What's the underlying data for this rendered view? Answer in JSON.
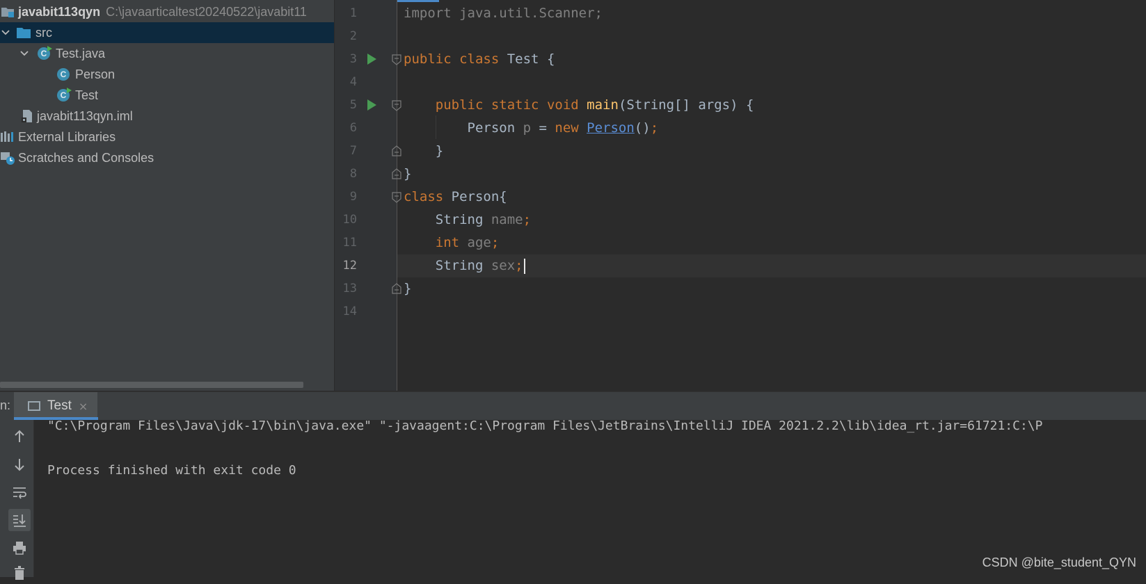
{
  "project_tree": {
    "root_name": "javabit113qyn",
    "root_path": "C:\\javaarticaltest20240522\\javabit11",
    "src_label": "src",
    "file_label": "Test.java",
    "class_person": "Person",
    "class_test": "Test",
    "iml_label": "javabit113qyn.iml",
    "external_libraries": "External Libraries",
    "scratches": "Scratches and Consoles"
  },
  "editor": {
    "line_numbers": [
      "1",
      "2",
      "3",
      "4",
      "5",
      "6",
      "7",
      "8",
      "9",
      "10",
      "11",
      "12",
      "13",
      "14"
    ],
    "current_line": "12",
    "code": {
      "l1_import": "import",
      "l1_rest": " java.util.Scanner;",
      "public": "public",
      "class": "class",
      "test_name": " Test ",
      "brace_open": "{",
      "static": "static",
      "void": "void",
      "main": "main",
      "main_args": "(String[] args) {",
      "person_type": "Person ",
      "var_p": "p",
      "assign": " = ",
      "new": "new",
      "person_ctor": "Person",
      "parens": "()",
      "semi": ";",
      "close_brace": "}",
      "person_decl": " Person{",
      "string_type": "String ",
      "name_field": "name",
      "int": "int",
      "age_field": "age",
      "sex_field": "sex"
    }
  },
  "run_panel": {
    "label": "n:",
    "tab_label": "Test",
    "tab_close": "×",
    "console_line1": "\"C:\\Program Files\\Java\\jdk-17\\bin\\java.exe\" \"-javaagent:C:\\Program Files\\JetBrains\\IntelliJ IDEA 2021.2.2\\lib\\idea_rt.jar=61721:C:\\P",
    "console_line2": "Process finished with exit code 0"
  },
  "watermark": "CSDN @bite_student_QYN",
  "colors": {
    "keyword": "#cc7832",
    "function": "#ffc66d",
    "link": "#5b8ed6",
    "selection": "#0d293e",
    "accent": "#4a88c7"
  }
}
